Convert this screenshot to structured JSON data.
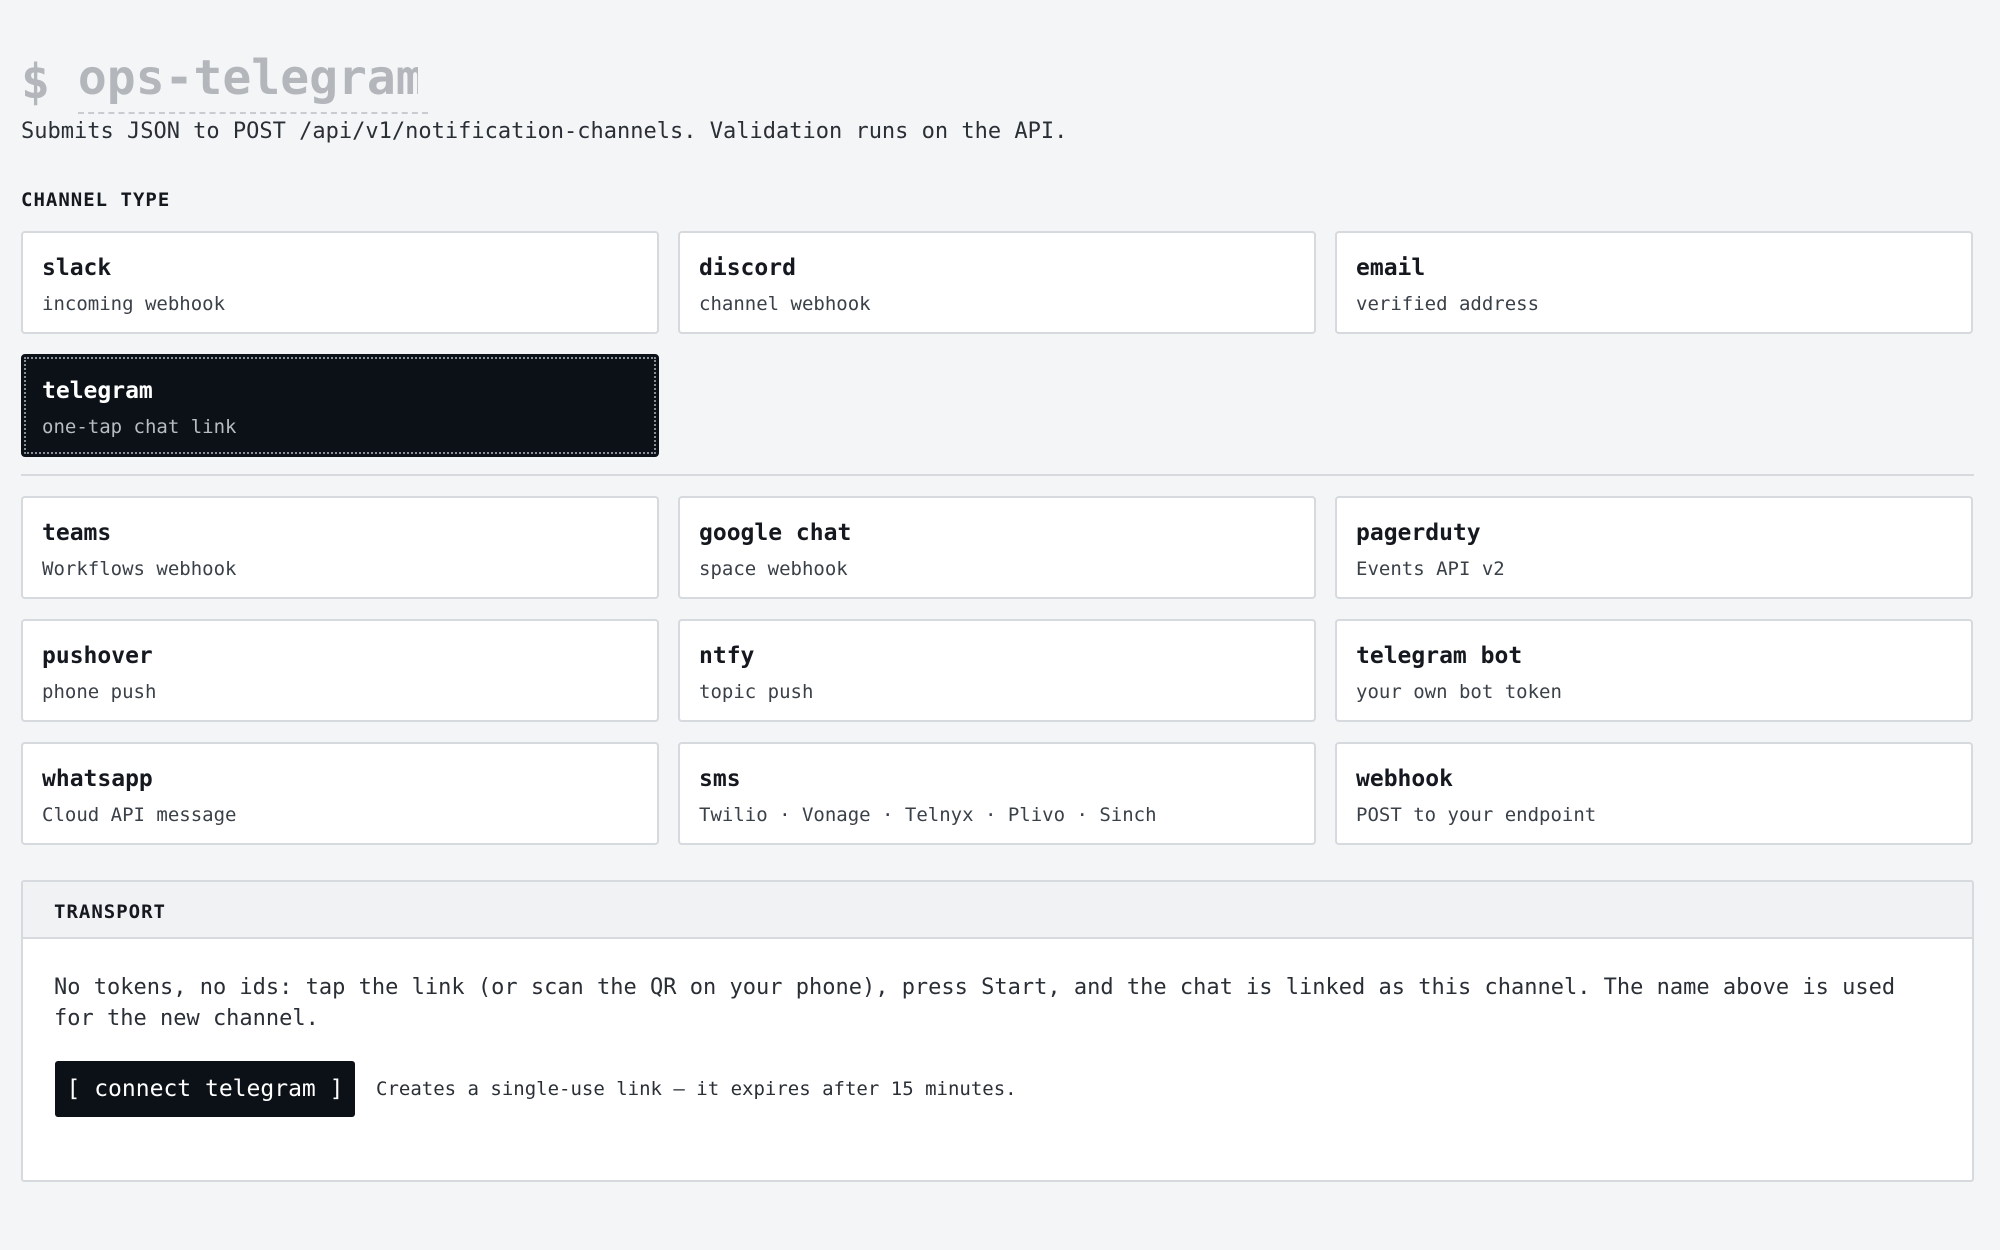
{
  "header": {
    "prompt": "$",
    "channel_name": "ops-telegram",
    "subtitle": "Submits JSON to POST /api/v1/notification-channels. Validation runs on the API."
  },
  "channel_type": {
    "label": "CHANNEL TYPE",
    "selected": "telegram",
    "primary": [
      {
        "title": "slack",
        "sub": "incoming webhook"
      },
      {
        "title": "discord",
        "sub": "channel webhook"
      },
      {
        "title": "email",
        "sub": "verified address"
      },
      {
        "title": "telegram",
        "sub": "one-tap chat link"
      }
    ],
    "more": [
      {
        "title": "teams",
        "sub": "Workflows webhook"
      },
      {
        "title": "google chat",
        "sub": "space webhook"
      },
      {
        "title": "pagerduty",
        "sub": "Events API v2"
      },
      {
        "title": "pushover",
        "sub": "phone push"
      },
      {
        "title": "ntfy",
        "sub": "topic push"
      },
      {
        "title": "telegram bot",
        "sub": "your own bot token"
      },
      {
        "title": "whatsapp",
        "sub": "Cloud API message"
      },
      {
        "title": "sms",
        "sub": "Twilio · Vonage · Telnyx · Plivo · Sinch"
      },
      {
        "title": "webhook",
        "sub": "POST to your endpoint"
      }
    ]
  },
  "transport": {
    "label": "TRANSPORT",
    "description": "No tokens, no ids: tap the link (or scan the QR on your phone), press Start, and the chat is linked as this channel. The name above is used for the new channel.",
    "button_label": "[ connect telegram ]",
    "hint": "Creates a single-use link — it expires after 15 minutes."
  },
  "colors": {
    "background": "#f4f5f7",
    "selected_card": "#0c1117",
    "card_border": "#d6d9dd",
    "muted_title": "#b3b6bb"
  }
}
